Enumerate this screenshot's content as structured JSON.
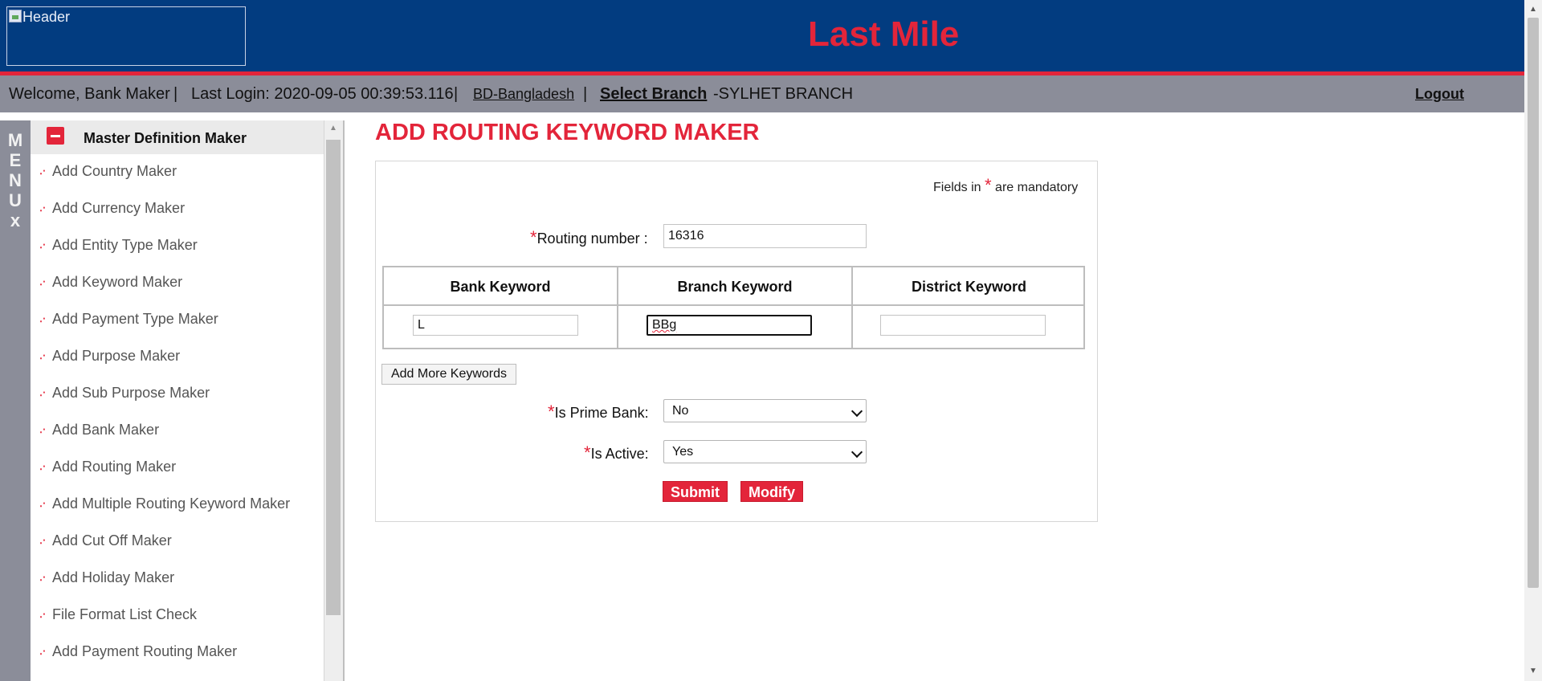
{
  "header": {
    "logo_alt": "Header",
    "app_title": "Last Mile"
  },
  "infobar": {
    "welcome": "Welcome, Bank Maker",
    "sep1": "|",
    "last_login": "Last Login: 2020-09-05 00:39:53.116",
    "sep2": "|",
    "country": "BD-Bangladesh",
    "sep3": "|",
    "select_branch": "Select Branch",
    "branch": "-SYLHET BRANCH",
    "logout": "Logout"
  },
  "menu": {
    "letters": [
      "M",
      "E",
      "N",
      "U"
    ],
    "close": "x"
  },
  "nav": {
    "section_title": "Master Definition Maker",
    "items": [
      {
        "label": "Add Country Maker"
      },
      {
        "label": "Add Currency Maker"
      },
      {
        "label": "Add Entity Type Maker"
      },
      {
        "label": "Add Keyword Maker"
      },
      {
        "label": "Add Payment Type Maker"
      },
      {
        "label": "Add Purpose Maker"
      },
      {
        "label": "Add Sub Purpose Maker"
      },
      {
        "label": "Add Bank Maker"
      },
      {
        "label": "Add Routing Maker"
      },
      {
        "label": "Add Multiple Routing Keyword Maker"
      },
      {
        "label": "Add Cut Off Maker"
      },
      {
        "label": "Add Holiday Maker"
      },
      {
        "label": "File Format List Check"
      },
      {
        "label": "Add Payment Routing Maker"
      }
    ]
  },
  "main": {
    "page_title": "ADD ROUTING KEYWORD MAKER",
    "mandatory_prefix": "Fields in",
    "mandatory_star": "*",
    "mandatory_suffix": "are mandatory",
    "routing_label": "Routing number :",
    "routing_value": "16316",
    "table": {
      "headers": [
        "Bank Keyword",
        "Branch Keyword",
        "District Keyword"
      ],
      "values": [
        "L",
        "BBg",
        ""
      ]
    },
    "add_more_label": "Add More Keywords",
    "prime_bank_label": "Is Prime Bank:",
    "prime_bank_value": "No",
    "is_active_label": "Is Active:",
    "is_active_value": "Yes",
    "submit_label": "Submit",
    "modify_label": "Modify"
  },
  "colors": {
    "header_bg": "#023c80",
    "accent_red": "#e3253a",
    "bar_gray": "#8b8d99"
  }
}
